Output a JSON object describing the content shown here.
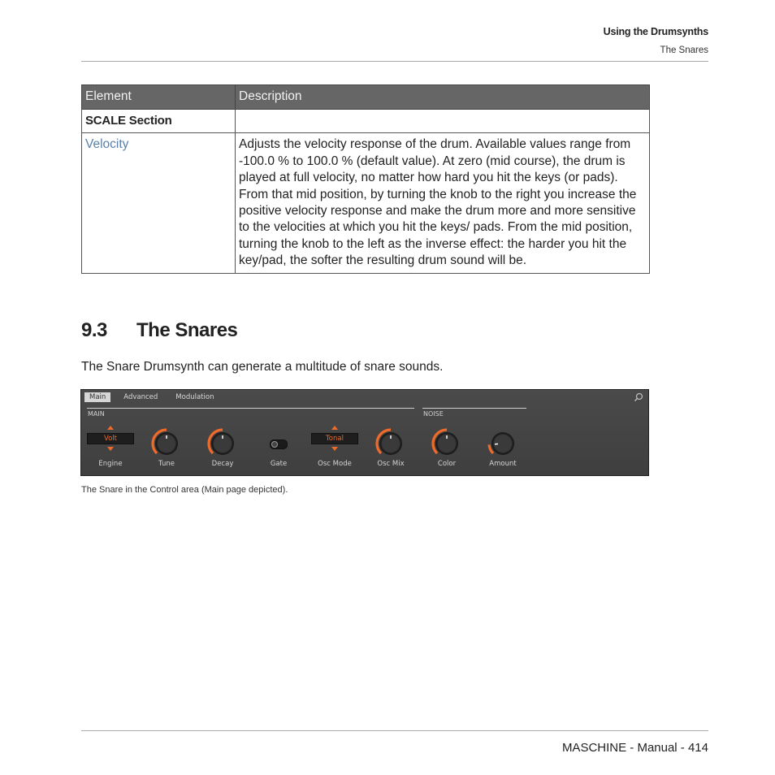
{
  "header": {
    "chapter": "Using the Drumsynths",
    "section": "The Snares"
  },
  "table": {
    "columns": [
      "Element",
      "Description"
    ],
    "section_row": "SCALE Section",
    "rows": [
      {
        "element": "Velocity",
        "description": "Adjusts the velocity response of the drum. Available values range from -100.0 % to 100.0 % (default value). At zero (mid course), the drum is played at full velocity, no matter how hard you hit the keys (or pads). From that mid position, by turning the knob to the right you increase the positive velocity response and make the drum more and more sensitive to the velocities at which you hit the keys/ pads. From the mid position, turning the knob to the left as the inverse effect: the harder you hit the key/pad, the softer the resulting drum sound will be."
      }
    ]
  },
  "heading": {
    "number": "9.3",
    "title": "The Snares"
  },
  "intro": "The Snare Drumsynth can generate a multitude of snare sounds.",
  "panel": {
    "tabs": [
      "Main",
      "Advanced",
      "Modulation"
    ],
    "active_tab": "Main",
    "search_icon": "search-icon",
    "sections": [
      {
        "name": "MAIN"
      },
      {
        "name": "NOISE"
      }
    ],
    "controls": [
      {
        "label": "Engine",
        "type": "selector",
        "value": "Volt"
      },
      {
        "label": "Tune",
        "type": "knob",
        "level": 0.5
      },
      {
        "label": "Decay",
        "type": "knob",
        "level": 0.5
      },
      {
        "label": "Gate",
        "type": "toggle",
        "on": false
      },
      {
        "label": "Osc Mode",
        "type": "selector",
        "value": "Tonal"
      },
      {
        "label": "Osc Mix",
        "type": "knob",
        "level": 0.5
      },
      {
        "label": "Color",
        "type": "knob",
        "level": 0.5
      },
      {
        "label": "Amount",
        "type": "knob",
        "level": 0.15
      }
    ],
    "accent_color": "#f06a2a"
  },
  "caption": "The Snare in the Control area (Main page depicted).",
  "footer": "MASCHINE - Manual - 414"
}
